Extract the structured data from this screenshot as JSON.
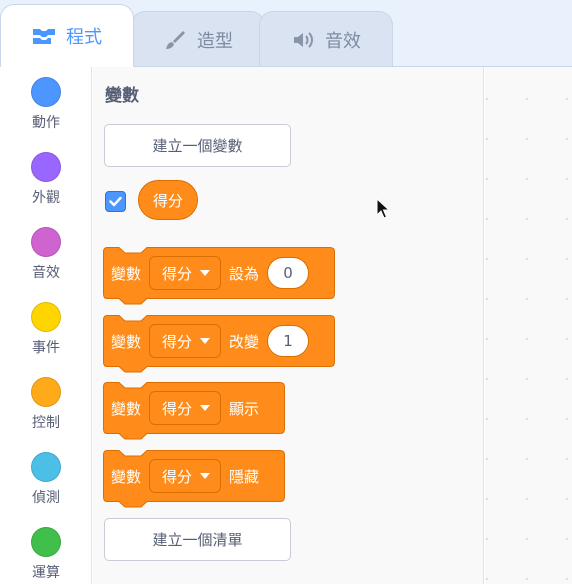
{
  "tabs": [
    {
      "label": "程式",
      "icon": "code-icon",
      "active": true
    },
    {
      "label": "造型",
      "icon": "paintbrush-icon",
      "active": false
    },
    {
      "label": "音效",
      "icon": "speaker-icon",
      "active": false
    }
  ],
  "categories": [
    {
      "label": "動作",
      "color": "#4c97ff"
    },
    {
      "label": "外觀",
      "color": "#9966ff"
    },
    {
      "label": "音效",
      "color": "#cf63cf"
    },
    {
      "label": "事件",
      "color": "#ffd500"
    },
    {
      "label": "控制",
      "color": "#ffab19"
    },
    {
      "label": "偵測",
      "color": "#4cbfe6"
    },
    {
      "label": "運算",
      "color": "#40bf4a"
    }
  ],
  "palette": {
    "title": "變數",
    "make_variable_label": "建立一個變數",
    "variable_name": "得分",
    "variable_checked": true,
    "make_list_label": "建立一個清單",
    "blocks": [
      {
        "prefix": "變數",
        "variable": "得分",
        "action": "設為",
        "value": "0"
      },
      {
        "prefix": "變數",
        "variable": "得分",
        "action": "改變",
        "value": "1"
      },
      {
        "prefix": "變數",
        "variable": "得分",
        "action": "顯示"
      },
      {
        "prefix": "變數",
        "variable": "得分",
        "action": "隱藏"
      }
    ]
  },
  "colors": {
    "accent": "#4c97ff",
    "variables_block": "#ff8c1a",
    "variables_border": "#db6e00",
    "text": "#575e75"
  }
}
